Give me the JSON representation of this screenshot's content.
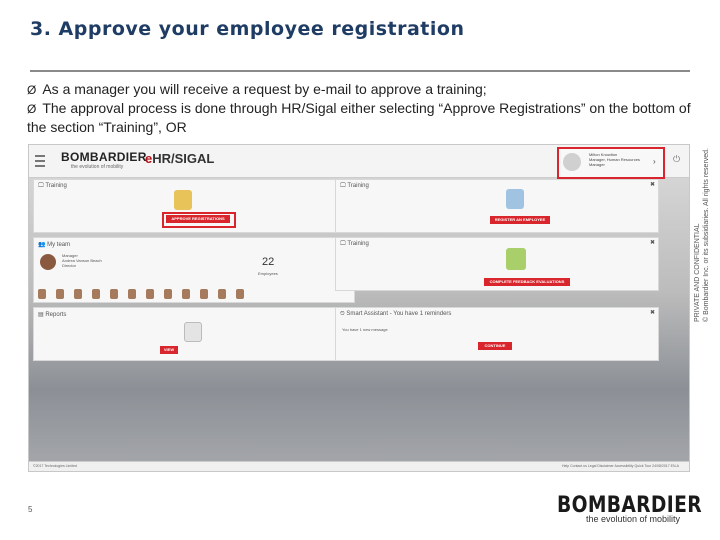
{
  "slide": {
    "title": "3. Approve your employee registration",
    "bullets": [
      "As a manager you will receive a request by e-mail to approve a training;",
      "The approval process is done through HR/Sigal either selecting “Approve Registrations” on the bottom of the section “Training”, OR"
    ],
    "bullet_marker": "Ø",
    "confidential_line1": "PRIVATE AND CONFIDENTIAL",
    "confidential_line2": "© Bombardier Inc. or its subsidiaries. All rights reserved.",
    "page_number": "5",
    "brand_name": "BOMBARDIER",
    "brand_tagline": "the evolution of mobility"
  },
  "app": {
    "logo": "BOMBARDIER",
    "logo_tagline": "the evolution of mobility",
    "module_prefix": "e",
    "module_name": "HR/SIGAL",
    "user_name": "Milton Knowlton",
    "user_role": "Manager, Human Resources",
    "user_role2": "Manager",
    "tiles": {
      "training_left": {
        "title": "Training",
        "button": "APPROVE REGISTRATIONS"
      },
      "training_right_top": {
        "title": "Training",
        "button": "REGISTER AN EMPLOYEE"
      },
      "my_team": {
        "title": "My team",
        "manager_label": "Manager",
        "manager_name": "Andrea Vanson Beach",
        "manager_role": "Director",
        "employee_count": "22",
        "employee_label": "Employees"
      },
      "training_right_mid": {
        "title": "Training",
        "button": "COMPLETE FEEDBACK EVALUATIONS"
      },
      "reports": {
        "title": "Reports",
        "button": "VIEW"
      },
      "smart_assistant": {
        "title": "Smart Assistant - You have 1 reminders",
        "message": "You have 1 new message",
        "button": "CONTINUE"
      }
    },
    "footer_left": "©2017 Technologies Limited",
    "footer_right": "Help   Contact us   Legal Disclaimer   Accessibility   Quick Tour   24/08/2017   EN-A"
  },
  "colors": {
    "title": "#1f3c64",
    "accent_red": "#d9262c"
  }
}
